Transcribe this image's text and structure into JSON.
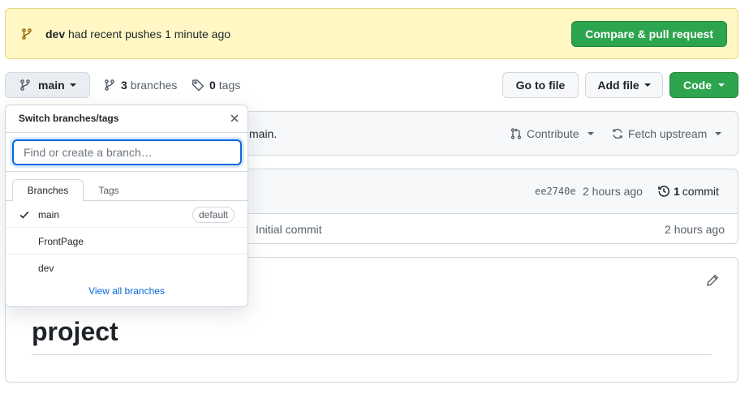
{
  "banner": {
    "branch": "dev",
    "message": "had recent pushes 1 minute ago",
    "compare_label": "Compare & pull request"
  },
  "toolbar": {
    "branch_label": "main",
    "branches_count": "3",
    "branches_label": "branches",
    "tags_count": "0",
    "tags_label": "tags",
    "goto_file": "Go to file",
    "add_file": "Add file",
    "code": "Code"
  },
  "sync": {
    "text": "main.",
    "contribute": "Contribute",
    "fetch_upstream": "Fetch upstream"
  },
  "commit": {
    "sha": "ee2740e",
    "time": "2 hours ago",
    "count": "1",
    "count_label": "commit",
    "file_message": "Initial commit",
    "file_age": "2 hours ago"
  },
  "readme": {
    "heading": "project"
  },
  "dropdown": {
    "title": "Switch branches/tags",
    "filter_placeholder": "Find or create a branch…",
    "tabs": [
      "Branches",
      "Tags"
    ],
    "items": [
      {
        "name": "main",
        "selected": true,
        "badge": "default"
      },
      {
        "name": "FrontPage"
      },
      {
        "name": "dev"
      }
    ],
    "footer": "View all branches"
  },
  "colors": {
    "banner_bg": "#fff8c5",
    "primary_green": "#2da44e",
    "link_blue": "#0969da"
  },
  "icons": [
    "git-branch-icon",
    "tag-icon",
    "git-pull-request-icon",
    "sync-icon",
    "history-icon",
    "pencil-icon",
    "close-icon",
    "check-icon"
  ]
}
